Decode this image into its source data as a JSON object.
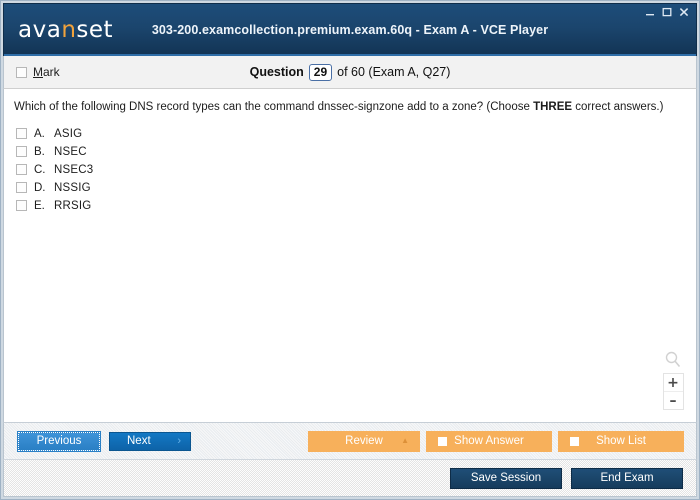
{
  "window": {
    "title": "303-200.examcollection.premium.exam.60q - Exam A - VCE Player",
    "logo_text_pre": "ava",
    "logo_text_accent": "n",
    "logo_text_post": "set",
    "controls": {
      "minimize": "minimize-icon",
      "maximize": "maximize-icon",
      "close": "close-icon"
    },
    "colors": {
      "titlebar_top": "#1d4d7a",
      "titlebar_bottom": "#123353",
      "accent_orange": "#f0a23c",
      "button_blue": "#1378c4",
      "button_orange": "#f7b05b",
      "button_dark": "#1f4e77"
    }
  },
  "question_header": {
    "mark_label_accel": "M",
    "mark_label_rest": "ark",
    "mark_checked": false,
    "question_word": "Question",
    "question_number": "29",
    "of_text": "of 60 (Exam A, Q27)"
  },
  "main": {
    "question_pre": "Which of the following DNS record types can the command dnssec-signzone add to a zone? (Choose ",
    "question_emphasis": "THREE",
    "question_post": " correct answers.)",
    "answers": [
      {
        "letter": "A.",
        "text": "ASIG",
        "checked": false
      },
      {
        "letter": "B.",
        "text": "NSEC",
        "checked": false
      },
      {
        "letter": "C.",
        "text": "NSEC3",
        "checked": false
      },
      {
        "letter": "D.",
        "text": "NSSIG",
        "checked": false
      },
      {
        "letter": "E.",
        "text": "RRSIG",
        "checked": false
      }
    ],
    "zoom_widget": {
      "magnifier_icon": "magnifier-icon",
      "zoom_in": "+",
      "zoom_out": "–"
    }
  },
  "toolbar": {
    "previous_label": "Previous",
    "next_label": "Next",
    "next_chevron": "›",
    "review_label": "Review",
    "review_caret": "▲",
    "show_answer_label": "Show Answer",
    "show_list_label": "Show List"
  },
  "footer": {
    "save_session_label": "Save Session",
    "end_exam_label": "End Exam"
  }
}
